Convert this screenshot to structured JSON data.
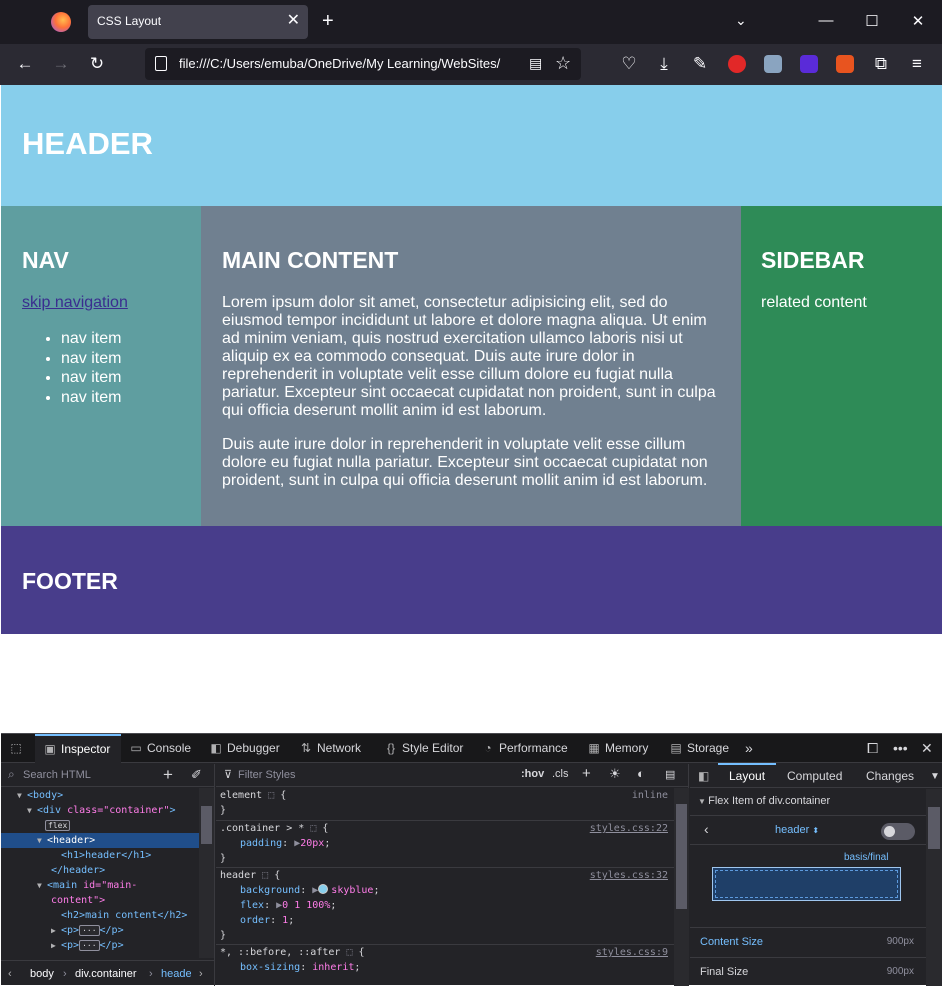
{
  "browser": {
    "tab_title": "CSS Layout",
    "url": "file:///C:/Users/emuba/OneDrive/My Learning/WebSites/"
  },
  "page": {
    "header": "HEADER",
    "nav_title": "NAV",
    "skip_link": "skip navigation",
    "nav_items": [
      "nav item",
      "nav item",
      "nav item",
      "nav item"
    ],
    "main_title": "MAIN CONTENT",
    "paragraph1": "Lorem ipsum dolor sit amet, consectetur adipisicing elit, sed do eiusmod tempor incididunt ut labore et dolore magna aliqua. Ut enim ad minim veniam, quis nostrud exercitation ullamco laboris nisi ut aliquip ex ea commodo consequat. Duis aute irure dolor in reprehenderit in voluptate velit esse cillum dolore eu fugiat nulla pariatur. Excepteur sint occaecat cupidatat non proident, sunt in culpa qui officia deserunt mollit anim id est laborum.",
    "paragraph2": "Duis aute irure dolor in reprehenderit in voluptate velit esse cillum dolore eu fugiat nulla pariatur. Excepteur sint occaecat cupidatat non proident, sunt in culpa qui officia deserunt mollit anim id est laborum.",
    "sidebar_title": "SIDEBAR",
    "sidebar_text": "related content",
    "footer": "FOOTER"
  },
  "devtools": {
    "tabs": [
      "Inspector",
      "Console",
      "Debugger",
      "Network",
      "Style Editor",
      "Performance",
      "Memory",
      "Storage"
    ],
    "search_placeholder": "Search HTML",
    "filter_placeholder": "Filter Styles",
    "hov": ":hov",
    "cls": ".cls",
    "tree": {
      "body": "<body>",
      "div_open": "<div",
      "div_attr": "class=",
      "div_val": "\"container\"",
      "div_close": ">",
      "flex_badge": "flex",
      "header_open": "<header>",
      "h1_line": "<h1>header</h1>",
      "header_close": "</header>",
      "main_open": "<main",
      "main_attr": "id=",
      "main_val": "\"main-",
      "main_val2": "content\">",
      "h2_line": "<h2>main content</h2>",
      "p_open": "<p>",
      "p_close": "</p>"
    },
    "breadcrumbs": [
      "body",
      "div.container",
      "header"
    ],
    "rules": {
      "r1_sel": "element",
      "r1_src": "inline",
      "r2_sel": ".container > *",
      "r2_src": "styles.css:22",
      "r2_prop": "padding",
      "r2_val": "20px",
      "r3_sel": "header",
      "r3_src": "styles.css:32",
      "r3_p1": "background",
      "r3_v1": "skyblue",
      "r3_p2": "flex",
      "r3_v2": "0 1 100%",
      "r3_p3": "order",
      "r3_v3": "1",
      "r4_sel": "*, ::before, ::after",
      "r4_src": "styles.css:9",
      "r4_prop": "box-sizing",
      "r4_val": "inherit"
    },
    "right_tabs": [
      "Layout",
      "Computed",
      "Changes"
    ],
    "flex_item_title": "Flex Item of div.container",
    "flex_element": "header",
    "basis_label": "basis/final",
    "content_size_label": "Content Size",
    "content_size_value": "900px",
    "final_size_label": "Final Size",
    "final_size_value": "900px"
  }
}
